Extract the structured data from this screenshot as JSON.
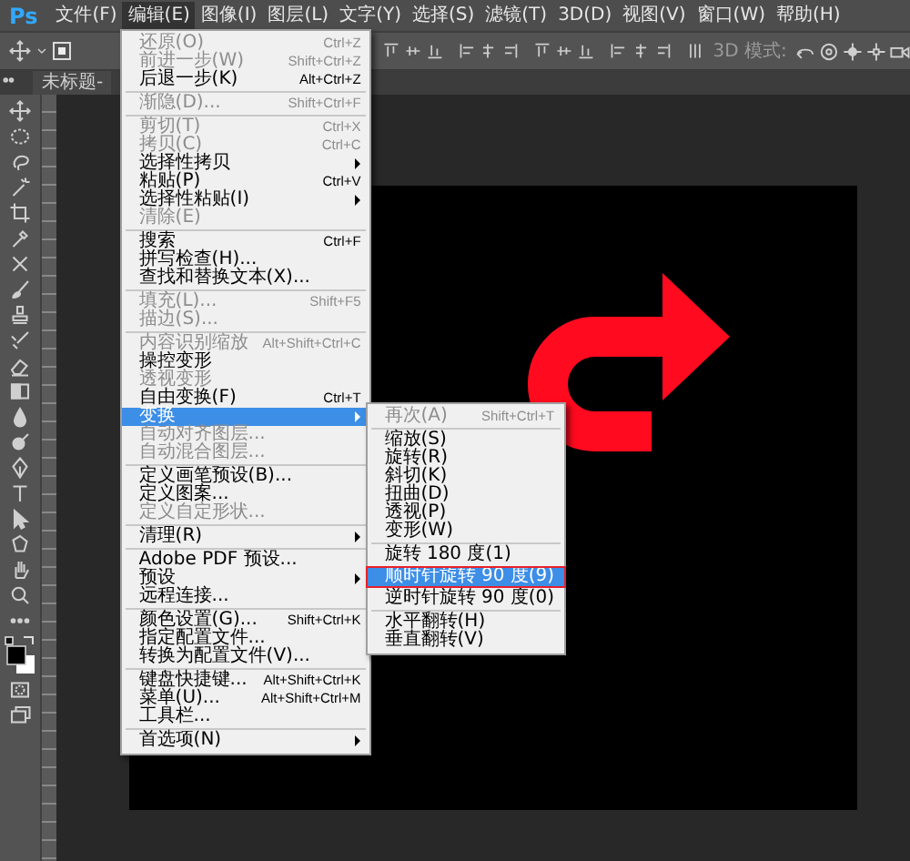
{
  "menubar": {
    "logo": "Ps",
    "items": [
      {
        "label": "文件(F)",
        "selected": false
      },
      {
        "label": "编辑(E)",
        "selected": true
      },
      {
        "label": "图像(I)",
        "selected": false
      },
      {
        "label": "图层(L)",
        "selected": false
      },
      {
        "label": "文字(Y)",
        "selected": false
      },
      {
        "label": "选择(S)",
        "selected": false
      },
      {
        "label": "滤镜(T)",
        "selected": false
      },
      {
        "label": "3D(D)",
        "selected": false
      },
      {
        "label": "视图(V)",
        "selected": false
      },
      {
        "label": "窗口(W)",
        "selected": false
      },
      {
        "label": "帮助(H)",
        "selected": false
      }
    ]
  },
  "options_bar": {
    "auto_select": {
      "checked": true
    },
    "mode_label": "3D 模式:"
  },
  "document_tab": {
    "title": "未标题-"
  },
  "edit_menu": {
    "items": [
      {
        "kind": "item",
        "label": "还原(O)",
        "shortcut": "Ctrl+Z",
        "disabled": true,
        "submenu": false,
        "selected": false
      },
      {
        "kind": "item",
        "label": "前进一步(W)",
        "shortcut": "Shift+Ctrl+Z",
        "disabled": true,
        "submenu": false,
        "selected": false
      },
      {
        "kind": "item",
        "label": "后退一步(K)",
        "shortcut": "Alt+Ctrl+Z",
        "disabled": false,
        "submenu": false,
        "selected": false
      },
      {
        "kind": "separator"
      },
      {
        "kind": "item",
        "label": "渐隐(D)...",
        "shortcut": "Shift+Ctrl+F",
        "disabled": true,
        "submenu": false,
        "selected": false
      },
      {
        "kind": "separator"
      },
      {
        "kind": "item",
        "label": "剪切(T)",
        "shortcut": "Ctrl+X",
        "disabled": true,
        "submenu": false,
        "selected": false
      },
      {
        "kind": "item",
        "label": "拷贝(C)",
        "shortcut": "Ctrl+C",
        "disabled": true,
        "submenu": false,
        "selected": false
      },
      {
        "kind": "item",
        "label": "选择性拷贝",
        "disabled": false,
        "submenu": true,
        "selected": false
      },
      {
        "kind": "item",
        "label": "粘贴(P)",
        "shortcut": "Ctrl+V",
        "disabled": false,
        "submenu": false,
        "selected": false
      },
      {
        "kind": "item",
        "label": "选择性粘贴(I)",
        "disabled": false,
        "submenu": true,
        "selected": false
      },
      {
        "kind": "item",
        "label": "清除(E)",
        "disabled": true,
        "submenu": false,
        "selected": false
      },
      {
        "kind": "separator"
      },
      {
        "kind": "item",
        "label": "搜索",
        "shortcut": "Ctrl+F",
        "disabled": false,
        "submenu": false,
        "selected": false
      },
      {
        "kind": "item",
        "label": "拼写检查(H)...",
        "disabled": false,
        "submenu": false,
        "selected": false
      },
      {
        "kind": "item",
        "label": "查找和替换文本(X)...",
        "disabled": false,
        "submenu": false,
        "selected": false
      },
      {
        "kind": "separator"
      },
      {
        "kind": "item",
        "label": "填充(L)...",
        "shortcut": "Shift+F5",
        "disabled": true,
        "submenu": false,
        "selected": false
      },
      {
        "kind": "item",
        "label": "描边(S)...",
        "disabled": true,
        "submenu": false,
        "selected": false
      },
      {
        "kind": "separator"
      },
      {
        "kind": "item",
        "label": "内容识别缩放",
        "shortcut": "Alt+Shift+Ctrl+C",
        "disabled": true,
        "submenu": false,
        "selected": false
      },
      {
        "kind": "item",
        "label": "操控变形",
        "disabled": false,
        "submenu": false,
        "selected": false
      },
      {
        "kind": "item",
        "label": "透视变形",
        "disabled": true,
        "submenu": false,
        "selected": false
      },
      {
        "kind": "item",
        "label": "自由变换(F)",
        "shortcut": "Ctrl+T",
        "disabled": false,
        "submenu": false,
        "selected": false
      },
      {
        "kind": "item",
        "label": "变换",
        "disabled": false,
        "submenu": true,
        "selected": true
      },
      {
        "kind": "item",
        "label": "自动对齐图层...",
        "disabled": true,
        "submenu": false,
        "selected": false
      },
      {
        "kind": "item",
        "label": "自动混合图层...",
        "disabled": true,
        "submenu": false,
        "selected": false
      },
      {
        "kind": "separator"
      },
      {
        "kind": "item",
        "label": "定义画笔预设(B)...",
        "disabled": false,
        "submenu": false,
        "selected": false
      },
      {
        "kind": "item",
        "label": "定义图案...",
        "disabled": false,
        "submenu": false,
        "selected": false
      },
      {
        "kind": "item",
        "label": "定义自定形状...",
        "disabled": true,
        "submenu": false,
        "selected": false
      },
      {
        "kind": "separator"
      },
      {
        "kind": "item",
        "label": "清理(R)",
        "disabled": false,
        "submenu": true,
        "selected": false
      },
      {
        "kind": "separator"
      },
      {
        "kind": "item",
        "label": "Adobe PDF 预设...",
        "disabled": false,
        "submenu": false,
        "selected": false
      },
      {
        "kind": "item",
        "label": "预设",
        "disabled": false,
        "submenu": true,
        "selected": false
      },
      {
        "kind": "item",
        "label": "远程连接...",
        "disabled": false,
        "submenu": false,
        "selected": false
      },
      {
        "kind": "separator"
      },
      {
        "kind": "item",
        "label": "颜色设置(G)...",
        "shortcut": "Shift+Ctrl+K",
        "disabled": false,
        "submenu": false,
        "selected": false
      },
      {
        "kind": "item",
        "label": "指定配置文件...",
        "disabled": false,
        "submenu": false,
        "selected": false
      },
      {
        "kind": "item",
        "label": "转换为配置文件(V)...",
        "disabled": false,
        "submenu": false,
        "selected": false
      },
      {
        "kind": "separator"
      },
      {
        "kind": "item",
        "label": "键盘快捷键...",
        "shortcut": "Alt+Shift+Ctrl+K",
        "disabled": false,
        "submenu": false,
        "selected": false
      },
      {
        "kind": "item",
        "label": "菜单(U)...",
        "shortcut": "Alt+Shift+Ctrl+M",
        "disabled": false,
        "submenu": false,
        "selected": false
      },
      {
        "kind": "item",
        "label": "工具栏...",
        "disabled": false,
        "submenu": false,
        "selected": false
      },
      {
        "kind": "separator"
      },
      {
        "kind": "item",
        "label": "首选项(N)",
        "disabled": false,
        "submenu": true,
        "selected": false
      }
    ]
  },
  "transform_submenu": {
    "items": [
      {
        "kind": "item",
        "label": "再次(A)",
        "shortcut": "Shift+Ctrl+T",
        "disabled": true,
        "submenu": false,
        "selected": false,
        "marked": false
      },
      {
        "kind": "separator"
      },
      {
        "kind": "item",
        "label": "缩放(S)",
        "disabled": false,
        "submenu": false,
        "selected": false,
        "marked": false
      },
      {
        "kind": "item",
        "label": "旋转(R)",
        "disabled": false,
        "submenu": false,
        "selected": false,
        "marked": false
      },
      {
        "kind": "item",
        "label": "斜切(K)",
        "disabled": false,
        "submenu": false,
        "selected": false,
        "marked": false
      },
      {
        "kind": "item",
        "label": "扭曲(D)",
        "disabled": false,
        "submenu": false,
        "selected": false,
        "marked": false
      },
      {
        "kind": "item",
        "label": "透视(P)",
        "disabled": false,
        "submenu": false,
        "selected": false,
        "marked": false
      },
      {
        "kind": "item",
        "label": "变形(W)",
        "disabled": false,
        "submenu": false,
        "selected": false,
        "marked": false
      },
      {
        "kind": "separator"
      },
      {
        "kind": "item",
        "label": "旋转 180 度(1)",
        "disabled": false,
        "submenu": false,
        "selected": false,
        "marked": false
      },
      {
        "kind": "item",
        "label": "顺时针旋转 90 度(9)",
        "disabled": false,
        "submenu": false,
        "selected": true,
        "marked": true
      },
      {
        "kind": "item",
        "label": "逆时针旋转 90 度(0)",
        "disabled": false,
        "submenu": false,
        "selected": false,
        "marked": false
      },
      {
        "kind": "separator"
      },
      {
        "kind": "item",
        "label": "水平翻转(H)",
        "disabled": false,
        "submenu": false,
        "selected": false,
        "marked": false
      },
      {
        "kind": "item",
        "label": "垂直翻转(V)",
        "disabled": false,
        "submenu": false,
        "selected": false,
        "marked": false
      }
    ]
  }
}
